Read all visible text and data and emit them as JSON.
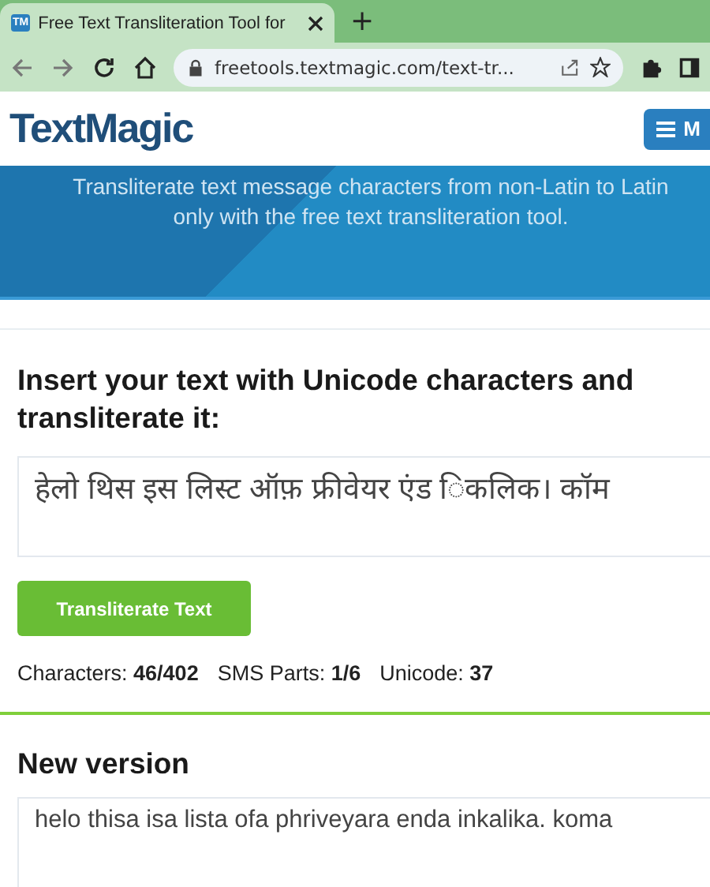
{
  "browser": {
    "tab": {
      "favicon": "TM",
      "title": "Free Text Transliteration Tool for ",
      "selected": true
    },
    "new_tab": "+",
    "url": "freetools.textmagic.com/text-tr..."
  },
  "header": {
    "logo": "TextMagic",
    "menu_button": "M"
  },
  "hero": {
    "subtitle": "Transliterate text message characters from non-Latin to Latin only with the free text transliteration tool."
  },
  "tool": {
    "heading": "Insert your text with Unicode characters and transliterate it:",
    "input": "हेलो थिस इस लिस्ट ऑफ़ फ्रीवेयर एंड िकलिक। कॉम",
    "button": "Transliterate Text",
    "stats": [
      "Characters: **46/402**",
      "SMS Parts: **1/6**",
      "Unicode: **37**"
    ]
  },
  "result": {
    "heading": "New version",
    "output": "helo thisa isa lista ofa phriveyara enda inkalika. koma"
  }
}
